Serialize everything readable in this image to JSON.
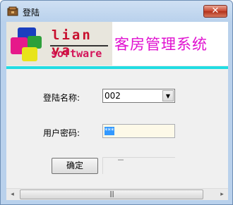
{
  "window": {
    "title": "登陆",
    "close_label": "✕"
  },
  "banner": {
    "logo_line1": "lian ya",
    "logo_line2": "software",
    "system_title": "客房管理系统"
  },
  "form": {
    "username_label": "登陆名称:",
    "username_value": "002",
    "password_label": "用户密码:",
    "password_value": "***",
    "ok_label": "确定"
  },
  "scrollbar": {
    "left_arrow": "◂",
    "right_arrow": "▸",
    "thumb_grip": "|||"
  },
  "colors": {
    "logo_blue": "#1a3fbf",
    "logo_pink": "#e6198a",
    "logo_green": "#2ea03a",
    "logo_yellow": "#e8e41a",
    "accent_cyan": "#22dde2",
    "title_magenta": "#e010d0"
  }
}
